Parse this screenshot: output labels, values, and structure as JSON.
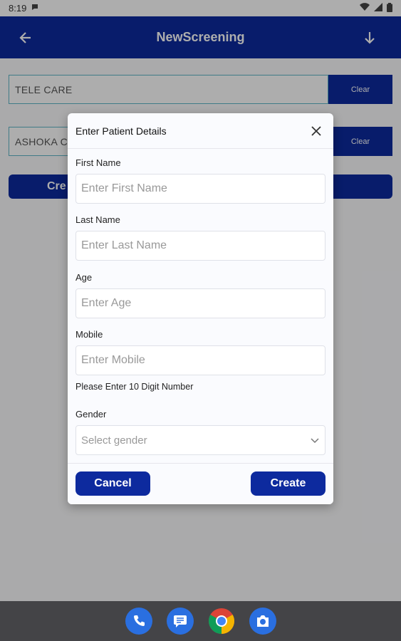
{
  "status_bar": {
    "time": "8:19",
    "icons": [
      "notification-icon",
      "wifi-icon",
      "signal-icon",
      "battery-icon"
    ]
  },
  "app_bar": {
    "title": "NewScreening",
    "back_icon": "arrow-left-icon",
    "action_icon": "arrow-down-icon"
  },
  "background_fields": [
    {
      "value": "TELE CARE",
      "clear_label": "Clear"
    },
    {
      "value": "ASHOKA  C",
      "clear_label": "Clear"
    }
  ],
  "background_create_label": "Cre",
  "dialog": {
    "title": "Enter Patient Details",
    "fields": {
      "first_name": {
        "label": "First Name",
        "placeholder": "Enter First Name"
      },
      "last_name": {
        "label": "Last Name",
        "placeholder": "Enter Last Name"
      },
      "age": {
        "label": "Age",
        "placeholder": "Enter Age"
      },
      "mobile": {
        "label": "Mobile",
        "placeholder": "Enter Mobile",
        "hint": "Please Enter 10 Digit Number"
      },
      "gender": {
        "label": "Gender",
        "placeholder": "Select gender"
      }
    },
    "cancel_label": "Cancel",
    "create_label": "Create"
  },
  "nav_bar": {
    "apps": [
      "phone-icon",
      "messages-icon",
      "chrome-icon",
      "camera-icon"
    ]
  },
  "colors": {
    "primary": "#0d2a9e",
    "field_border": "#5fb6c8",
    "nav_bar": "#444447"
  }
}
